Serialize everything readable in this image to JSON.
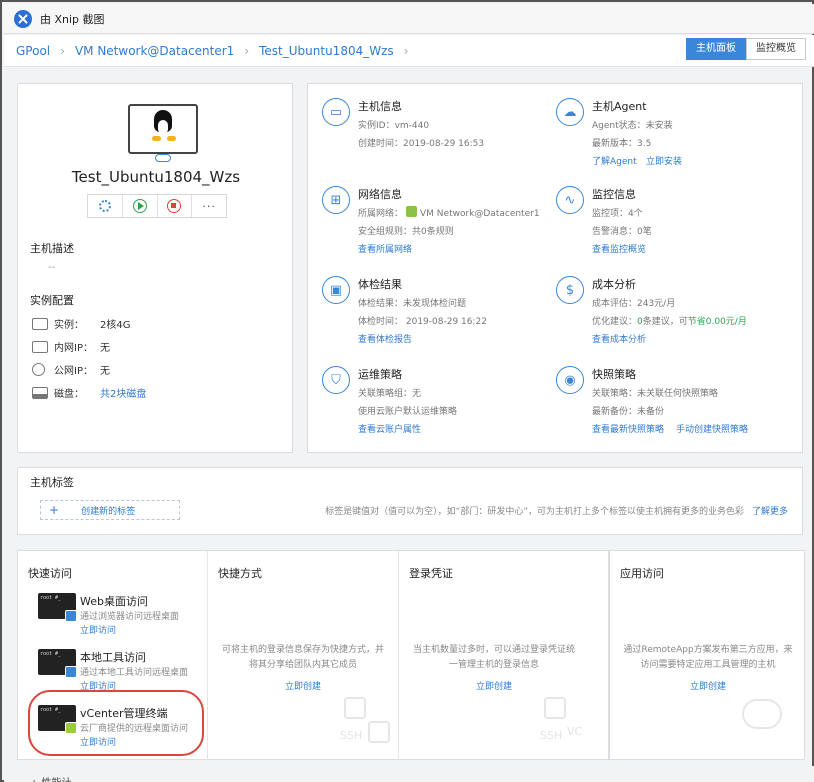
{
  "window": {
    "title": "由 Xnip 截图"
  },
  "breadcrumb": [
    "GPool",
    "VM Network@Datacenter1",
    "Test_Ubuntu1804_Wzs"
  ],
  "view_tabs": [
    {
      "label": "主机面板",
      "active": true
    },
    {
      "label": "监控概览",
      "active": false
    }
  ],
  "vm": {
    "name": "Test_Ubuntu1804_Wzs",
    "actions": [
      "settings-icon",
      "start-icon",
      "stop-icon",
      "more"
    ],
    "more_label": "···",
    "desc_title": "主机描述",
    "desc_value": "--",
    "config_title": "实例配置",
    "specs": [
      {
        "label": "实例：",
        "value": "2核4G",
        "link": false
      },
      {
        "label": "内网IP：",
        "value": "无",
        "link": false
      },
      {
        "label": "公网IP：",
        "value": "无",
        "link": false
      },
      {
        "label": "磁盘：",
        "value": "共2块磁盘",
        "link": true
      }
    ]
  },
  "info": {
    "host": {
      "title": "主机信息",
      "line1": "实例ID：vm-440",
      "line2": "创建时间：2019-08-29 16:53"
    },
    "agent": {
      "title": "主机Agent",
      "line1": "Agent状态：未安装",
      "line2": "最新版本：3.5",
      "link1": "了解Agent",
      "link2": "立即安装"
    },
    "network": {
      "title": "网络信息",
      "line1_prefix": "所属网络：",
      "line1_value": "VM Network@Datacenter1",
      "line2": "安全组规则：共0条规则",
      "link1": "查看所属网络"
    },
    "monitor": {
      "title": "监控信息",
      "line1": "监控项：4个",
      "line2": "告警消息：0笔",
      "link1": "查看监控概览"
    },
    "health": {
      "title": "体检结果",
      "line1": "体检结果：未发现体检问题",
      "line2": "体检时间： 2019-08-29 16:22",
      "link1": "查看体检报告"
    },
    "cost": {
      "title": "成本分析",
      "line1": "成本评估：243元/月",
      "line2_prefix": "优化建议：",
      "line2_count": "0",
      "line2_mid": "条建议，可",
      "line2_save": "节省0.00元/月",
      "link1": "查看成本分析"
    },
    "ops": {
      "title": "运维策略",
      "line1": "关联策略组：无",
      "line2": "使用云账户默认运维策略",
      "link1": "查看云账户属性"
    },
    "snapshot": {
      "title": "快照策略",
      "line1": "关联策略：未关联任何快照策略",
      "line2": "最新备份：未备份",
      "link1": "查看最新快照策略",
      "link2": "手动创建快照策略"
    }
  },
  "tags": {
    "title": "主机标签",
    "add_plus": "+",
    "add_label": "创建新的标签",
    "hint": "标签是键值对（值可以为空），如“部门：研发中心”，可为主机打上多个标签以使主机拥有更多的业务色彩",
    "hint_link": "了解更多"
  },
  "quick_access": {
    "title": "快速访问",
    "terminal_text": "root #_",
    "items": [
      {
        "title": "Web桌面访问",
        "desc": "通过浏览器访问远程桌面",
        "link": "立即访问"
      },
      {
        "title": "本地工具访问",
        "desc": "通过本地工具访问远程桌面",
        "link": "立即访问"
      },
      {
        "title": "vCenter管理终端",
        "desc": "云厂商提供的远程桌面访问",
        "link": "立即访问"
      }
    ]
  },
  "shortcut": {
    "title": "快捷方式",
    "text": "可将主机的登录信息保存为快捷方式，并将其分享给团队内其它成员",
    "link": "立即创建"
  },
  "credential": {
    "title": "登录凭证",
    "text": "当主机数量过多时，可以通过登录凭证统一管理主机的登录信息",
    "link": "立即创建"
  },
  "app_access": {
    "title": "应用访问",
    "text": "通过RemoteApp方案发布第三方应用，来访问需要特定应用工具管理的主机",
    "link": "立即创建"
  },
  "watermark": {
    "ssh": "SSH",
    "vc": "VC"
  },
  "footer": {
    "partial_title": "+ 性能计"
  },
  "colors": {
    "accent": "#3a86d8",
    "link": "#2e7bd1",
    "success": "#2aa44f",
    "danger": "#e0403a",
    "highlight": "#d9473b"
  }
}
